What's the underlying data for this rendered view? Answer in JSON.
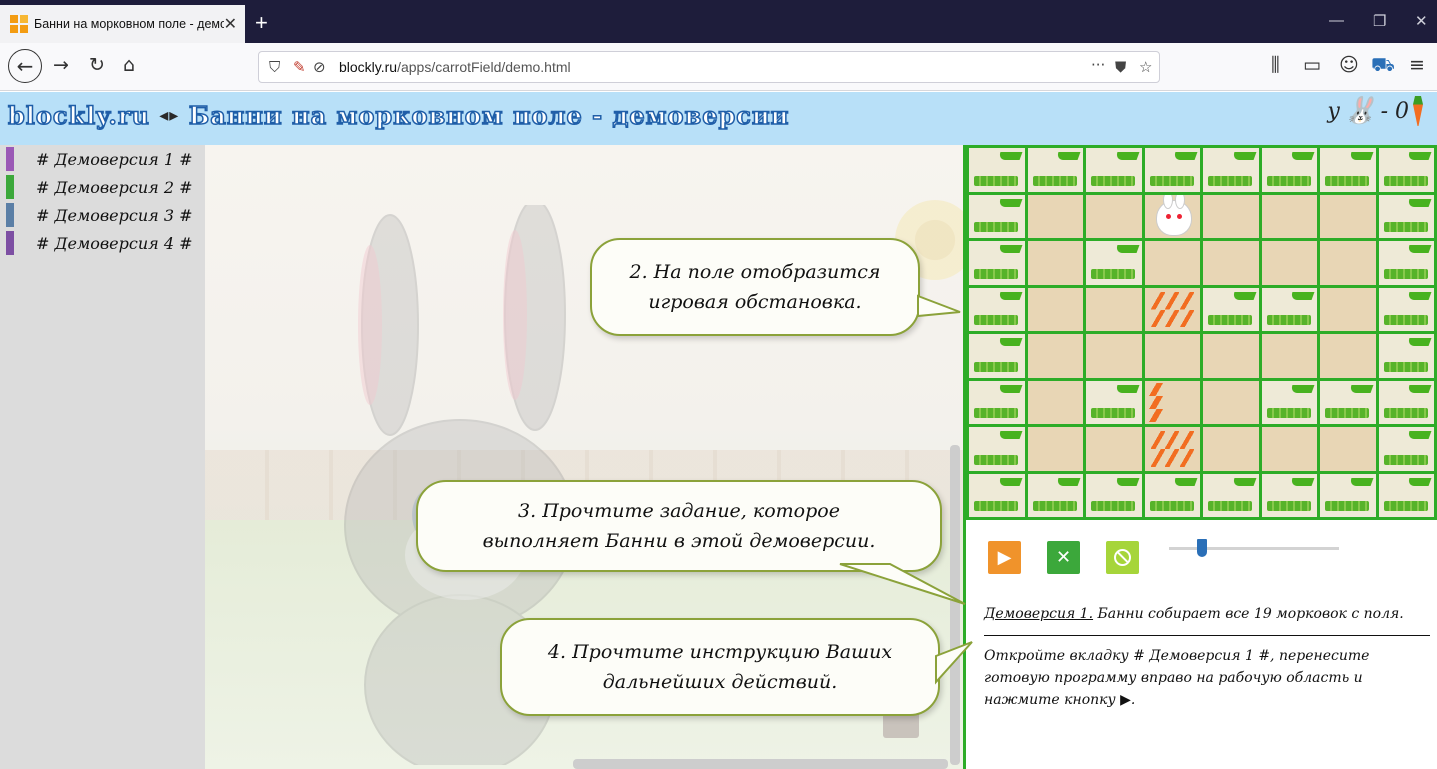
{
  "browser": {
    "tab_title": "Банни на морковном поле - демоверсии",
    "tab_close": "✕",
    "new_tab": "+",
    "url_host": "blockly.ru",
    "url_path": "/apps/carrotField/demo.html",
    "minimize": "—",
    "maximize": "❐",
    "close": "✕",
    "more_menu": "···"
  },
  "header": {
    "site": "blockly.ru",
    "arrows": "◂▸",
    "title": "Банни на морковном поле - демоверсии",
    "score_prefix": "у",
    "score_value": "- 0"
  },
  "sidebar": {
    "items": [
      {
        "label": "# Демоверсия 1 #",
        "color": "#9b59b6"
      },
      {
        "label": "# Демоверсия 2 #",
        "color": "#3ca83b"
      },
      {
        "label": "# Демоверсия 3 #",
        "color": "#5b7fa6"
      },
      {
        "label": "# Демоверсия 4 #",
        "color": "#7d4fa3"
      }
    ]
  },
  "field": {
    "rows": [
      [
        "wall",
        "wall",
        "wall",
        "wall",
        "wall",
        "wall",
        "wall",
        "wall"
      ],
      [
        "wall",
        "empty",
        "empty",
        "bunny",
        "empty",
        "empty",
        "empty",
        "wall"
      ],
      [
        "wall",
        "empty",
        "wall",
        "empty",
        "empty",
        "empty",
        "empty",
        "wall"
      ],
      [
        "wall",
        "empty",
        "empty",
        "carrot",
        "wall",
        "wall",
        "empty",
        "wall"
      ],
      [
        "wall",
        "empty",
        "empty",
        "empty",
        "empty",
        "empty",
        "empty",
        "wall"
      ],
      [
        "wall",
        "empty",
        "wall",
        "carrot1",
        "empty",
        "wall",
        "wall",
        "wall"
      ],
      [
        "wall",
        "empty",
        "empty",
        "carrot",
        "empty",
        "empty",
        "empty",
        "wall"
      ],
      [
        "wall",
        "wall",
        "wall",
        "wall",
        "wall",
        "wall",
        "wall",
        "wall"
      ]
    ]
  },
  "controls": {
    "play_label": "▶",
    "clear_label": "✕",
    "stop_label": "⃠"
  },
  "task": {
    "demo_link": "Демоверсия 1.",
    "text": " Банни собирает все 19 морковок с поля."
  },
  "instructions": "Откройте вкладку # Демоверсия 1 #, перенесите готовую программу вправо на рабочую область и нажмите кнопку ▶.",
  "callouts": {
    "c2": "2. На поле отобразится игровая обстановка.",
    "c3": "3. Прочтите задание, которое выполняет Банни в этой демоверсии.",
    "c4": "4. Прочтите инструкцию Ваших дальнейших действий."
  },
  "colors": {
    "accent_green": "#2dac27",
    "header_blue": "#b8e0f8",
    "play_orange": "#f0932b"
  }
}
